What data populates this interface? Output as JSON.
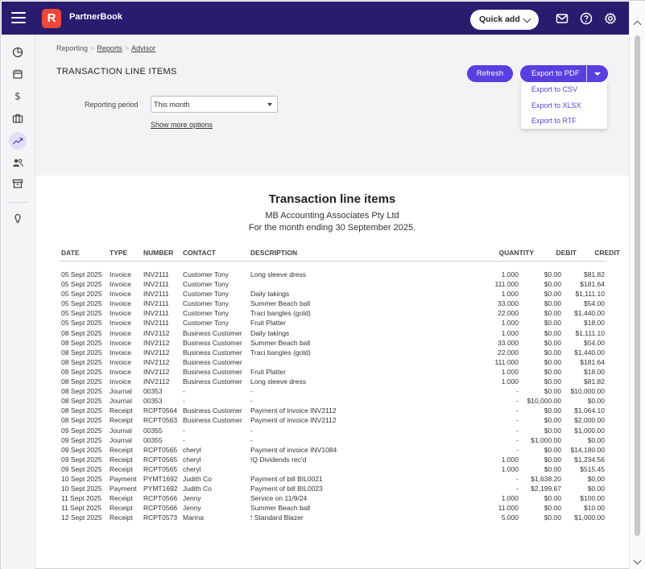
{
  "app": {
    "name": "PartnerBook",
    "logo_letter": "R",
    "quick_add": "Quick add"
  },
  "top_icons": [
    "mail-icon",
    "help-icon",
    "settings-icon"
  ],
  "sidebar": {
    "items": [
      "dashboard-icon",
      "calendar-icon",
      "dollar-icon",
      "briefcase-icon",
      "reporting-icon",
      "contacts-icon",
      "archive-icon",
      "lightbulb-icon"
    ],
    "active": "reporting-icon"
  },
  "breadcrumb": {
    "items": [
      "Reporting",
      "Reports",
      "Advisor"
    ]
  },
  "page_title": "TRANSACTION LINE ITEMS",
  "buttons": {
    "refresh": "Refresh",
    "export": "Export to PDF"
  },
  "export_menu": [
    "Export to CSV",
    "Export to XLSX",
    "Export to RTF"
  ],
  "filters": {
    "period_label": "Reporting period",
    "period_value": "This month",
    "more_options": "Show more options"
  },
  "report": {
    "title": "Transaction line items",
    "organisation": "MB Accounting Associates Pty Ltd",
    "period": "For the month ending 30 September 2025.",
    "columns": [
      "DATE",
      "TYPE",
      "NUMBER",
      "CONTACT",
      "DESCRIPTION",
      "QUANTITY",
      "DEBIT",
      "CREDIT"
    ],
    "rows": [
      [
        "05 Sept 2025",
        "Invoice",
        "INV2111",
        "Customer Tony",
        "Long sleeve dress",
        "1.000",
        "$0.00",
        "$81.82"
      ],
      [
        "05 Sept 2025",
        "Invoice",
        "INV2111",
        "Customer Tony",
        "",
        "111.000",
        "$0.00",
        "$181.64"
      ],
      [
        "05 Sept 2025",
        "Invoice",
        "INV2111",
        "Customer Tony",
        "Daily takings",
        "1.000",
        "$0.00",
        "$1,111.10"
      ],
      [
        "05 Sept 2025",
        "Invoice",
        "INV2111",
        "Customer Tony",
        "Summer Beach ball",
        "33.000",
        "$0.00",
        "$54.00"
      ],
      [
        "05 Sept 2025",
        "Invoice",
        "INV2111",
        "Customer Tony",
        "Traci bangles (gold)",
        "22.000",
        "$0.00",
        "$1,440.00"
      ],
      [
        "05 Sept 2025",
        "Invoice",
        "INV2111",
        "Customer Tony",
        "Fruit Platter",
        "1.000",
        "$0.00",
        "$18.00"
      ],
      [
        "08 Sept 2025",
        "Invoice",
        "INV2112",
        "Business Customer",
        "Daily takings",
        "1.000",
        "$0.00",
        "$1,111.10"
      ],
      [
        "08 Sept 2025",
        "Invoice",
        "INV2112",
        "Business Customer",
        "Summer Beach ball",
        "33.000",
        "$0.00",
        "$54.00"
      ],
      [
        "08 Sept 2025",
        "Invoice",
        "INV2112",
        "Business Customer",
        "Traci bangles (gold)",
        "22.000",
        "$0.00",
        "$1,440.00"
      ],
      [
        "08 Sept 2025",
        "Invoice",
        "INV2112",
        "Business Customer",
        "",
        "111.000",
        "$0.00",
        "$181.64"
      ],
      [
        "08 Sept 2025",
        "Invoice",
        "INV2112",
        "Business Customer",
        "Fruit Platter",
        "1.000",
        "$0.00",
        "$18.00"
      ],
      [
        "08 Sept 2025",
        "Invoice",
        "INV2112",
        "Business Customer",
        "Long sleeve dress",
        "1.000",
        "$0.00",
        "$81.82"
      ],
      [
        "08 Sept 2025",
        "Journal",
        "00353",
        "-",
        "-",
        "-",
        "$0.00",
        "$10,000.00"
      ],
      [
        "08 Sept 2025",
        "Journal",
        "00353",
        "-",
        "-",
        "-",
        "$10,000.00",
        "$0.00"
      ],
      [
        "08 Sept 2025",
        "Receipt",
        "RCPT0564",
        "Business Customer",
        "Payment of invoice INV2112",
        "-",
        "$0.00",
        "$1,064.10"
      ],
      [
        "08 Sept 2025",
        "Receipt",
        "RCPT0563",
        "Business Customer",
        "Payment of invoice INV2112",
        "-",
        "$0.00",
        "$2,000.00"
      ],
      [
        "09 Sept 2025",
        "Journal",
        "00355",
        "-",
        "-",
        "-",
        "$0.00",
        "$1,000.00"
      ],
      [
        "09 Sept 2025",
        "Journal",
        "00355",
        "-",
        "-",
        "-",
        "$1,000.00",
        "$0.00"
      ],
      [
        "09 Sept 2025",
        "Receipt",
        "RCPT0565",
        "cheryl",
        "Payment of invoice INV1084",
        "-",
        "$0.00",
        "$14,180.00"
      ],
      [
        "09 Sept 2025",
        "Receipt",
        "RCPT0565",
        "cheryl",
        "!Q Dividends rec'd",
        "1.000",
        "$0.00",
        "$1,234.56"
      ],
      [
        "09 Sept 2025",
        "Receipt",
        "RCPT0565",
        "cheryl",
        "",
        "1.000",
        "$0.00",
        "$515.45"
      ],
      [
        "10 Sept 2025",
        "Payment",
        "PYMT1692",
        "Judith Co",
        "Payment of bill BIL0021",
        "-",
        "$1,638.20",
        "$0.00"
      ],
      [
        "10 Sept 2025",
        "Payment",
        "PYMT1692",
        "Judith Co",
        "Payment of bill BIL0023",
        "-",
        "$2,199.67",
        "$0.00"
      ],
      [
        "11 Sept 2025",
        "Receipt",
        "RCPT0566",
        "Jenny",
        "Service on 11/9/24",
        "1.000",
        "$0.00",
        "$100.00"
      ],
      [
        "11 Sept 2025",
        "Receipt",
        "RCPT0566",
        "Jenny",
        "Summer Beach ball",
        "11.000",
        "$0.00",
        "$10.00"
      ],
      [
        "12 Sept 2025",
        "Receipt",
        "RCPT0573",
        "Marina",
        "! Standard Blazer",
        "5.000",
        "$0.00",
        "$1,000.00"
      ]
    ]
  },
  "colors": {
    "topbar": "#2a1b6e",
    "accent": "#5b3ee0",
    "logo": "#f0473b"
  }
}
